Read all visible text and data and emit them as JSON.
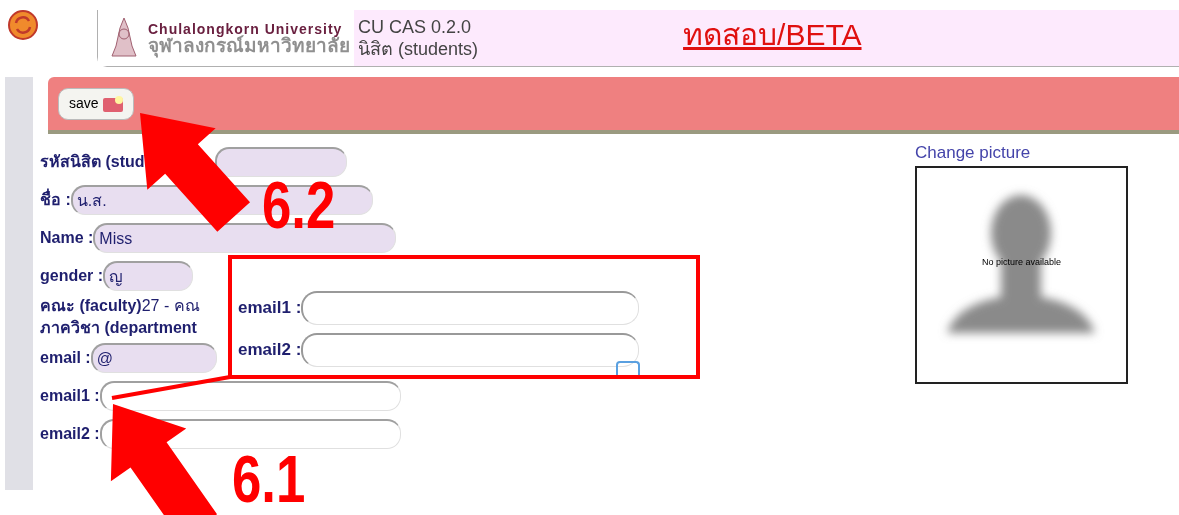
{
  "header": {
    "logo_en": "Chulalongkorn University",
    "logo_th": "จุฬาลงกรณ์มหาวิทยาลัย",
    "app_title": "CU CAS 0.2.0",
    "role": "นิสิต (students)",
    "beta_label": "ทดสอบ/BETA"
  },
  "toolbar": {
    "buttons": [
      {
        "label": "save"
      }
    ]
  },
  "form": {
    "fields": [
      {
        "kind": "input",
        "label": "รหัสนิสิต (stud",
        "shaded": true
      },
      {
        "kind": "input",
        "label": "ชื่อ :",
        "value": "น.ส.",
        "shaded": true
      },
      {
        "kind": "input",
        "label": "Name :",
        "value": "Miss",
        "shaded": true
      },
      {
        "kind": "input",
        "label": "gender :",
        "value": "ญ",
        "shaded": true
      },
      {
        "kind": "text",
        "label": "คณะ (faculty)",
        "value": "27 - คณ"
      },
      {
        "kind": "text",
        "label": "ภาควิชา (department"
      },
      {
        "kind": "input",
        "label": "email :",
        "value": "@",
        "shaded": true
      },
      {
        "kind": "input",
        "label": "email1 :",
        "shaded": false
      },
      {
        "kind": "input",
        "label": "email2 :",
        "shaded": false
      }
    ]
  },
  "photo": {
    "link": "Change picture",
    "caption": "No picture available"
  },
  "callout": {
    "fields": [
      {
        "label": "email1 :"
      },
      {
        "label": "email2 :"
      }
    ]
  },
  "annotations": [
    {
      "kind": "arrow",
      "label": "6.2"
    },
    {
      "kind": "arrow",
      "label": "6.1"
    }
  ]
}
